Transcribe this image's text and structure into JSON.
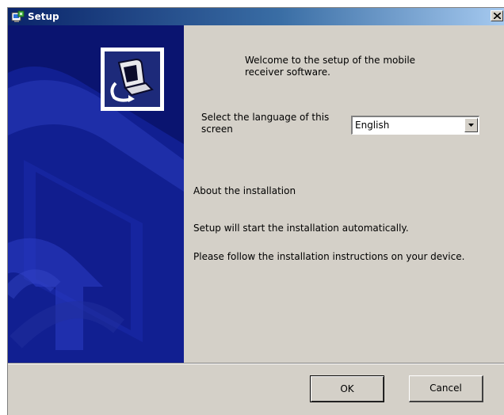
{
  "window": {
    "title": "Setup",
    "close_glyph": "✕"
  },
  "content": {
    "welcome_text": "Welcome to the setup of the mobile receiver software.",
    "language_label": "Select the language of this screen",
    "language_selected": "English",
    "about_heading": "About the installation",
    "auto_text": "Setup will start the installation automatically.",
    "follow_text": "Please follow the installation instructions on your device."
  },
  "buttons": {
    "ok_label": "OK",
    "cancel_label": "Cancel"
  },
  "icons": {
    "title": "setup-app-icon",
    "logo": "computer-install-logo",
    "close": "close-icon",
    "dropdown": "chevron-down-icon"
  },
  "colors": {
    "titlebar_start": "#0a246a",
    "titlebar_end": "#a6caf0",
    "banner_blue": "#0a1470",
    "dialog_face": "#d4d0c8"
  }
}
